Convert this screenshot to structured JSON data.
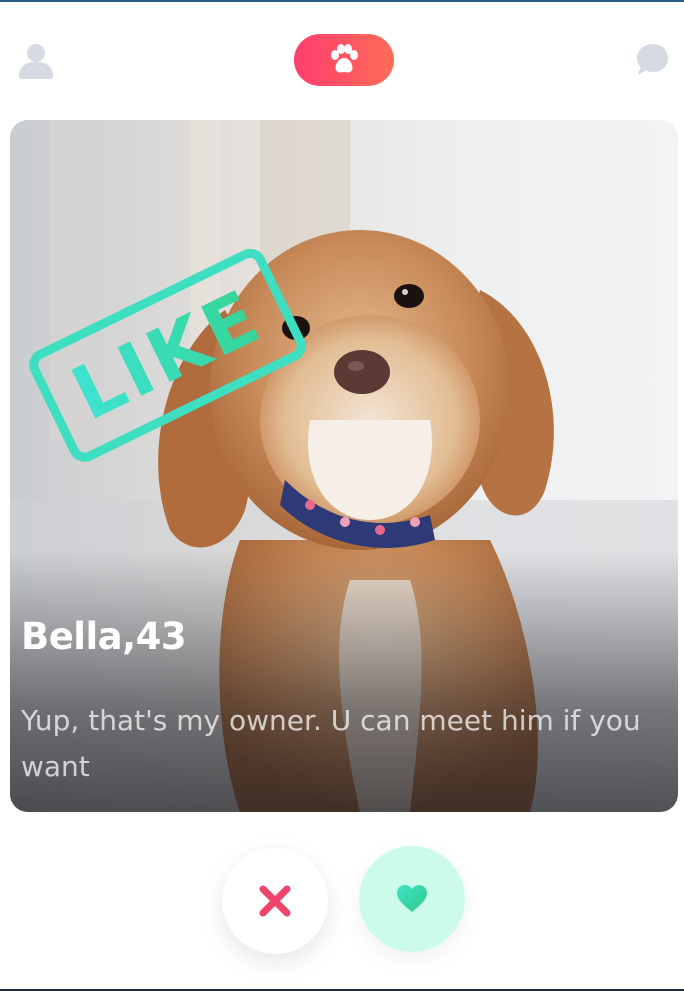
{
  "header": {
    "profile_icon": "person-icon",
    "center_icon": "paw-icon",
    "chat_icon": "chat-bubble-icon"
  },
  "card": {
    "stamp_text": "LIKE",
    "name_age": "Bella,43",
    "bio": "Yup, that's my owner. U can meet him if you want",
    "photo": "dog-photo"
  },
  "actions": {
    "dislike_icon": "close-icon",
    "like_icon": "heart-icon"
  },
  "colors": {
    "accent_pink": "#fe3d6e",
    "accent_orange": "#ff6b57",
    "like_green": "#35d496",
    "like_button_bg": "#ccfbe9",
    "dislike_red": "#f0446a",
    "icon_gray": "#d6dbe3"
  }
}
